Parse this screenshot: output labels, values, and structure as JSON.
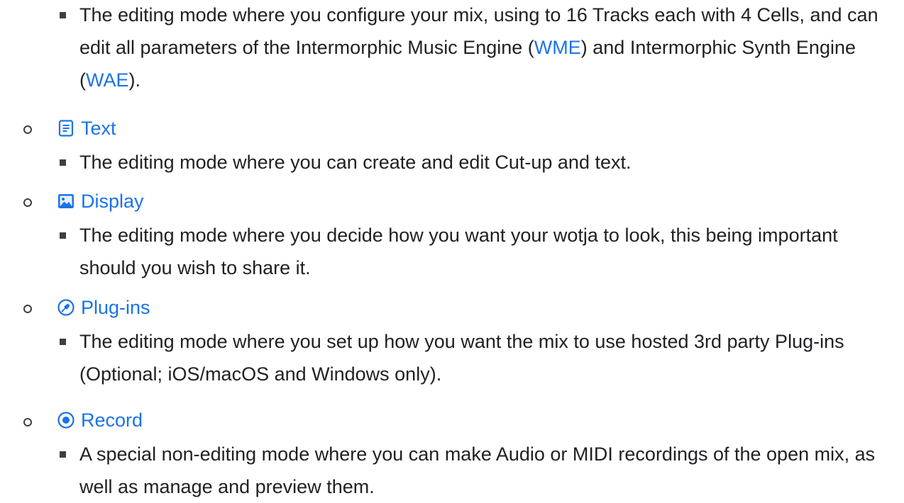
{
  "intro": {
    "before_wme": "The editing mode where you configure your mix, using to 16 Tracks each with 4 Cells, and can edit all parameters of the Intermorphic Music Engine (",
    "wme_link": "WME",
    "between": ") and Intermorphic Synth Engine (",
    "wae_link": "WAE",
    "after_wae": ")."
  },
  "items": [
    {
      "label": "Text",
      "icon": "document-icon",
      "description": "The editing mode where you can create and edit Cut-up and text."
    },
    {
      "label": "Display",
      "icon": "image-icon",
      "description": "The editing mode where you decide how you want your wotja to look, this being important should you wish to share it."
    },
    {
      "label": "Plug-ins",
      "icon": "plug-icon",
      "description": "The editing mode where you set up how you want the mix to use hosted 3rd party Plug-ins (Optional; iOS/macOS and Windows only)."
    },
    {
      "label": "Record",
      "icon": "record-icon",
      "description": "A special non-editing mode where you can make Audio or MIDI recordings of the open mix, as well as manage and preview them."
    }
  ],
  "colors": {
    "link": "#1a73e8",
    "text": "#202124",
    "bullet": "#3c4043"
  }
}
